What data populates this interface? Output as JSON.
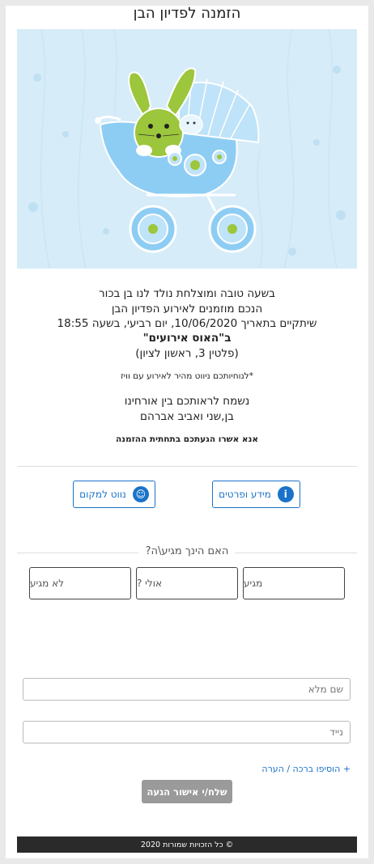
{
  "page": {
    "title": "הזמנה לפדיון הבן"
  },
  "message": {
    "line1": "בשעה טובה ומוצלחת נולד לנו בן בכור",
    "line2": "הנכם מוזמנים לאירוע הפדיון הבן",
    "line3": "שיתקיים בתאריך 10/06/2020, יום רביעי, בשעה 18:55",
    "venue": "ב\"האוס אירועים\"",
    "address": "(פלטין 3, ראשון לציון)",
    "note": "*לנוחיותכם ניווט מהיר לאירוע עם וויז",
    "greeting": "נשמח לראותכם בין אורחינו",
    "hosts": "בן,שני ואביב אברהם",
    "confirm": "אנא אשרו הגעתכם בתחתית ההזמנה"
  },
  "actions": {
    "info_label": "מידע ופרטים",
    "info_icon": "info-icon",
    "nav_label": "נווט למקום",
    "nav_icon": "waze-icon"
  },
  "rsvp": {
    "question": "האם הינך מגיע\\ה?",
    "options": [
      "מגיע",
      "אולי ?",
      "לא מגיע"
    ]
  },
  "form": {
    "name_placeholder": "שם מלא",
    "phone_placeholder": "נייד",
    "add_blessing": "+ הוסיפו ברכה / הערה",
    "submit": "שלח/י אישור הגעה"
  },
  "footer": {
    "text": "© כל הזכויות שמורות 2020"
  },
  "colors": {
    "accent": "#1a73c9",
    "hero_bg": "#d6ecf8",
    "bunny": "#9cc63b",
    "carriage": "#8ecdf3"
  }
}
